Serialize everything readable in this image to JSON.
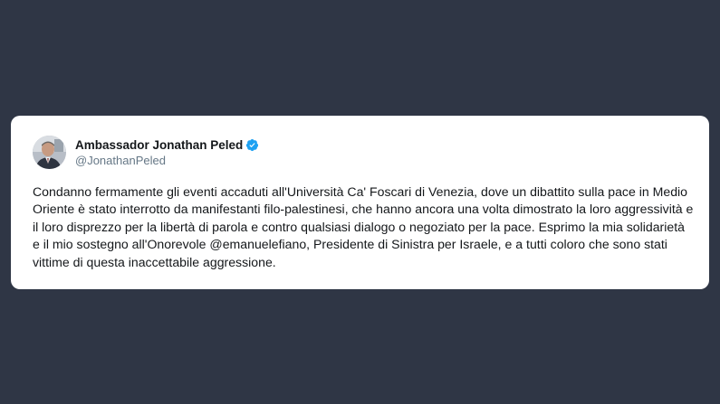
{
  "tweet": {
    "author": {
      "display_name": "Ambassador Jonathan Peled",
      "handle": "@JonathanPeled",
      "verified": true
    },
    "text": "Condanno fermamente gli eventi accaduti all'Università Ca' Foscari di Venezia, dove un dibattito sulla pace in Medio Oriente è stato interrotto da manifestanti filo-palestinesi, che hanno ancora una volta dimostrato la loro aggressività e il loro disprezzo per la libertà di parola e contro qualsiasi dialogo o negoziato per la pace. Esprimo la mia solidarietà e il mio sostegno all'Onorevole @emanuelefiano, Presidente di Sinistra per Israele, e a tutti coloro che sono stati vittime di questa inaccettabile aggressione."
  },
  "colors": {
    "background": "#2f3645",
    "card": "#ffffff",
    "verified_badge": "#1da1f2",
    "text_primary": "#14171a",
    "text_secondary": "#657786"
  },
  "icons": {
    "verified": "verified-badge-icon",
    "avatar": "profile-photo"
  }
}
